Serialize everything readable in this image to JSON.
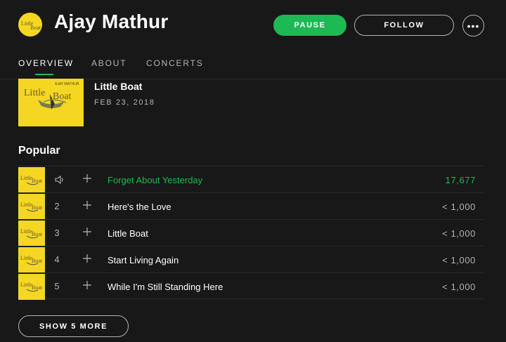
{
  "artist": {
    "name": "Ajay Mathur",
    "avatar_color": "#f5d622"
  },
  "header": {
    "pause_label": "PAUSE",
    "follow_label": "FOLLOW",
    "more_label": "•••"
  },
  "tabs": [
    {
      "label": "OVERVIEW",
      "active": true
    },
    {
      "label": "ABOUT",
      "active": false
    },
    {
      "label": "CONCERTS",
      "active": false
    }
  ],
  "release": {
    "title": "Little Boat",
    "date": "FEB 23, 2018",
    "cover_artist": "AJAY MATHUR",
    "cover_title_1": "Little",
    "cover_title_2": "Boat"
  },
  "popular": {
    "heading": "Popular",
    "tracks": [
      {
        "number": "",
        "title": "Forget About Yesterday",
        "plays": "17,677",
        "playing": true
      },
      {
        "number": "2",
        "title": "Here's the Love",
        "plays": "< 1,000",
        "playing": false
      },
      {
        "number": "3",
        "title": "Little Boat",
        "plays": "< 1,000",
        "playing": false
      },
      {
        "number": "4",
        "title": "Start Living Again",
        "plays": "< 1,000",
        "playing": false
      },
      {
        "number": "5",
        "title": "While I'm Still Standing Here",
        "plays": "< 1,000",
        "playing": false
      }
    ],
    "show_more_label": "SHOW 5 MORE"
  },
  "colors": {
    "accent": "#1db954",
    "background": "#181818",
    "cover_yellow": "#f5d622"
  },
  "icons": {
    "speaker": "speaker-icon",
    "plus": "plus-icon",
    "more": "more-icon"
  }
}
